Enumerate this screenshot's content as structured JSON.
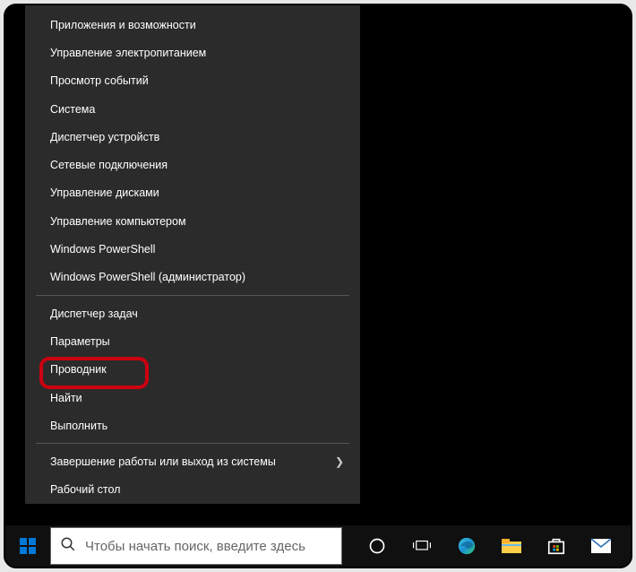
{
  "context_menu": {
    "groups": [
      {
        "items": [
          {
            "id": "apps-features",
            "label": "Приложения и возможности"
          },
          {
            "id": "power-options",
            "label": "Управление электропитанием"
          },
          {
            "id": "event-viewer",
            "label": "Просмотр событий"
          },
          {
            "id": "system",
            "label": "Система"
          },
          {
            "id": "device-manager",
            "label": "Диспетчер устройств"
          },
          {
            "id": "network-connections",
            "label": "Сетевые подключения"
          },
          {
            "id": "disk-management",
            "label": "Управление дисками"
          },
          {
            "id": "computer-management",
            "label": "Управление компьютером"
          },
          {
            "id": "powershell",
            "label": "Windows PowerShell"
          },
          {
            "id": "powershell-admin",
            "label": "Windows PowerShell (администратор)"
          }
        ]
      },
      {
        "items": [
          {
            "id": "task-manager",
            "label": "Диспетчер задач"
          },
          {
            "id": "settings",
            "label": "Параметры"
          },
          {
            "id": "file-explorer",
            "label": "Проводник",
            "highlighted": true
          },
          {
            "id": "search",
            "label": "Найти"
          },
          {
            "id": "run",
            "label": "Выполнить"
          }
        ]
      },
      {
        "items": [
          {
            "id": "shutdown-signout",
            "label": "Завершение работы или выход из системы",
            "has_submenu": true
          },
          {
            "id": "desktop",
            "label": "Рабочий стол"
          }
        ]
      }
    ]
  },
  "taskbar": {
    "search_placeholder": "Чтобы начать поиск, введите здесь"
  },
  "highlight": {
    "visible": true
  },
  "colors": {
    "menu_bg": "#2b2b2b",
    "taskbar_bg": "#101010",
    "accent_red": "#cc0010",
    "win_blue": "#0078d7"
  }
}
